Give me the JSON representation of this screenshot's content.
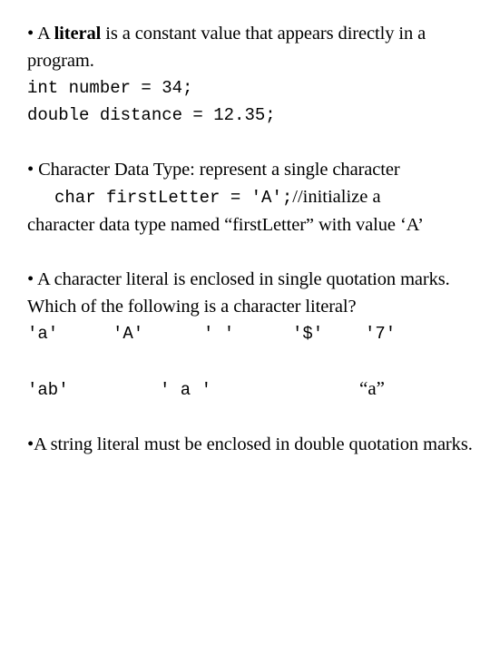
{
  "slide": {
    "background_color": "#ffffff",
    "text_color": "#000000",
    "blocks": {
      "literal_bullet": {
        "bullet": "•",
        "lead": " A ",
        "bold_word": "literal",
        "rest": " is a constant value that appears directly in a program."
      },
      "code_int": "int number = 34;",
      "code_double": "double distance = 12.35;",
      "char_bullet": {
        "bullet": "•",
        "text": " Character Data Type: represent a single character"
      },
      "char_code": {
        "code": "char firstLetter = 'A';",
        "comment": "//initialize a"
      },
      "char_explain": "character data type named “firstLetter” with value ‘A’",
      "char_literal_bullet": {
        "bullet": "•",
        "text": " A character literal is enclosed in single quotation marks.  Which of the following is a character literal?"
      },
      "literals_row_1": [
        "'a'",
        "'A'",
        "' '",
        "'$'",
        "'7'"
      ],
      "literals_row_2": [
        "'ab'",
        "' a '",
        "“a”"
      ],
      "string_bullet": {
        "bullet": "•",
        "text": "A string literal must be enclosed in double quotation marks."
      }
    }
  }
}
